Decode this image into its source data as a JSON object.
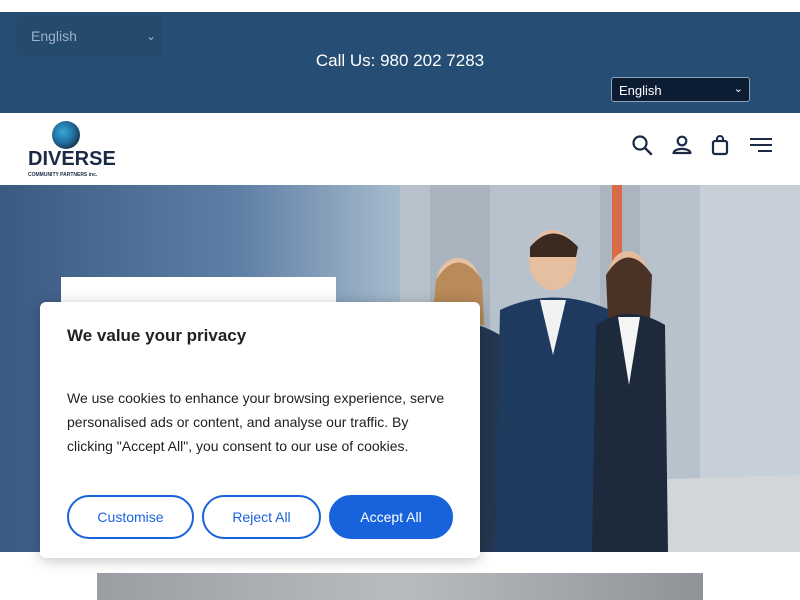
{
  "topbar": {
    "language_left": "English",
    "call_text": "Call Us: 980 202 7283",
    "language_right": "English"
  },
  "header": {
    "logo_word": "DIVERSE",
    "logo_sub": "COMMUNITY PARTNERS inc.",
    "icons": [
      "search-icon",
      "account-icon",
      "bag-icon",
      "menu-icon"
    ]
  },
  "cookie": {
    "title": "We value your privacy",
    "text": "We use cookies to enhance your browsing experience, serve personalised ads or content, and analyse our traffic. By clicking \"Accept All\", you consent to our use of cookies.",
    "customise": "Customise",
    "reject": "Reject All",
    "accept": "Accept All"
  },
  "colors": {
    "topbar_bg": "#264d73",
    "accent": "#1863dc",
    "logo_text": "#1b2a45"
  }
}
